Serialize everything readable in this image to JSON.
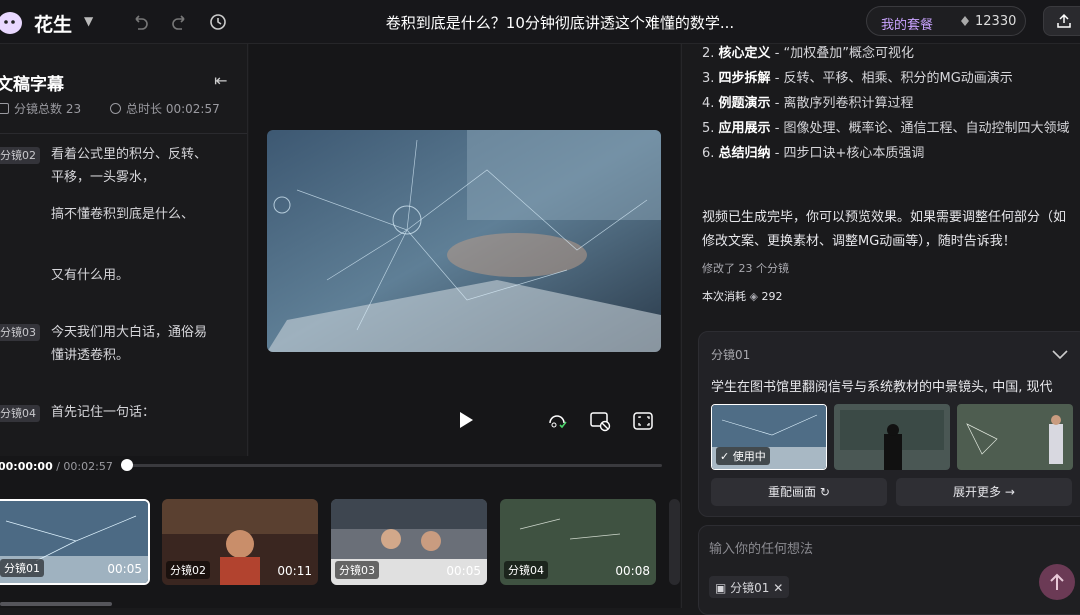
{
  "app": {
    "name": "花生",
    "title": "卷积到底是什么？10分钟彻底讲透这个难懂的数学..."
  },
  "account": {
    "plan": "我的套餐",
    "credits": "12330"
  },
  "script_panel": {
    "title": "文稿字幕",
    "shot_count": "分镜总数 23",
    "total_duration": "总时长 00:02:57",
    "segments": [
      {
        "badge": "分镜02",
        "lines": [
          "看着公式里的积分、反转、平移，一头雾水，",
          "搞不懂卷积到底是什么、",
          "又有什么用。"
        ]
      },
      {
        "badge": "分镜03",
        "lines": [
          "今天我们用大白话，通俗易懂讲透卷积。"
        ]
      },
      {
        "badge": "分镜04",
        "lines": [
          "首先记住一句话："
        ]
      }
    ]
  },
  "player": {
    "time_current": "00:00:00",
    "time_total": "/ 00:02:57",
    "progress": 0.0
  },
  "timeline": {
    "clips": [
      {
        "label": "分镜01",
        "duration": "00:05",
        "selected": true
      },
      {
        "label": "分镜02",
        "duration": "00:11",
        "selected": false
      },
      {
        "label": "分镜03",
        "duration": "00:05",
        "selected": false
      },
      {
        "label": "分镜04",
        "duration": "00:08",
        "selected": false
      }
    ]
  },
  "chat": {
    "outline": [
      {
        "n": "2.",
        "bold": "核心定义",
        "rest": " - “加权叠加”概念可视化"
      },
      {
        "n": "3.",
        "bold": "四步拆解",
        "rest": " - 反转、平移、相乘、积分的MG动画演示"
      },
      {
        "n": "4.",
        "bold": "例题演示",
        "rest": " - 离散序列卷积计算过程"
      },
      {
        "n": "5.",
        "bold": "应用展示",
        "rest": " - 图像处理、概率论、通信工程、自动控制四大领域"
      },
      {
        "n": "6.",
        "bold": "总结归纳",
        "rest": " - 四步口诀+核心本质强调"
      }
    ],
    "summary": "视频已生成完毕，你可以预览效果。如果需要调整任何部分（如修改文案、更换素材、调整MG动画等），随时告诉我！",
    "modified": "修改了 23 个分镜",
    "consume_label": "本次消耗",
    "consume_value": "292"
  },
  "shot_card": {
    "label": "分镜01",
    "description": "学生在图书馆里翻阅信号与系统教材的中景镜头, 中国, 现代",
    "in_use": "使用中",
    "rematch": "重配画面",
    "expand": "展开更多"
  },
  "composer": {
    "placeholder": "输入你的任何想法",
    "chip": "分镜01"
  }
}
